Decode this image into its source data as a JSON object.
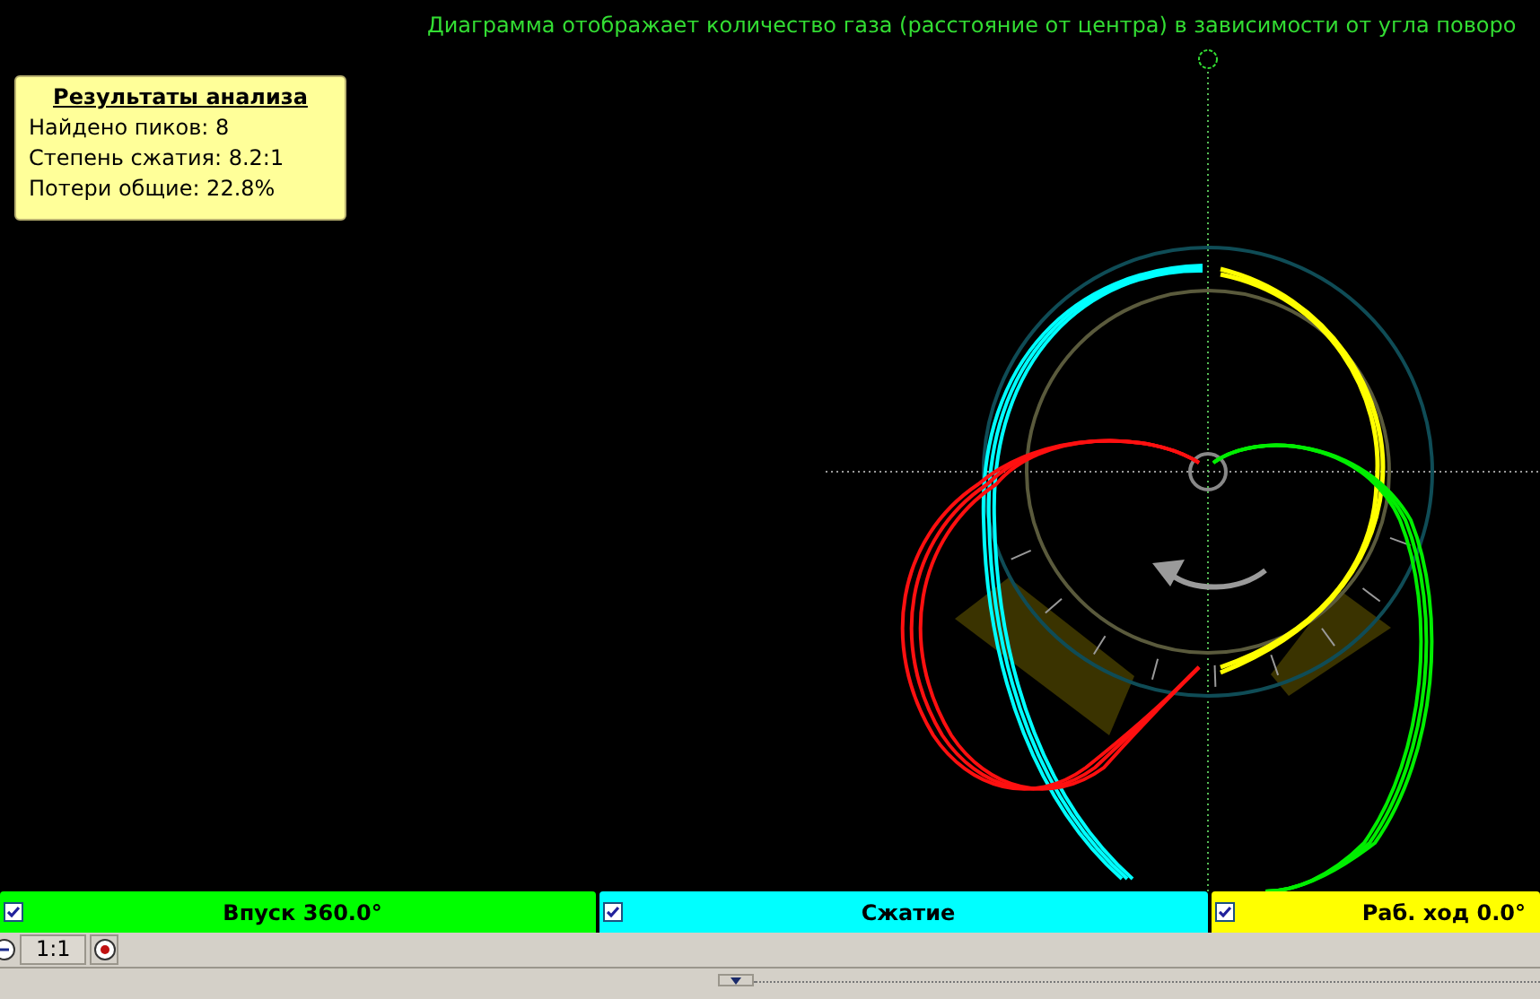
{
  "caption": "Диаграмма отображает количество газа (расстояние от центра) в зависимости от угла поворо",
  "results": {
    "title": "Результаты анализа",
    "lines": [
      "Найдено пиков: 8",
      "Степень сжатия: 8.2:1",
      "Потери общие: 22.8%"
    ]
  },
  "legend": [
    {
      "label": "Впуск 360.0°",
      "color": "#00ff00",
      "checked": true
    },
    {
      "label": "Сжатие",
      "color": "#00ffff",
      "checked": true
    },
    {
      "label": "Раб. ход 0.0°",
      "color": "#ffff00",
      "checked": true
    }
  ],
  "toolbar": {
    "zoom_label": "1:1"
  }
}
